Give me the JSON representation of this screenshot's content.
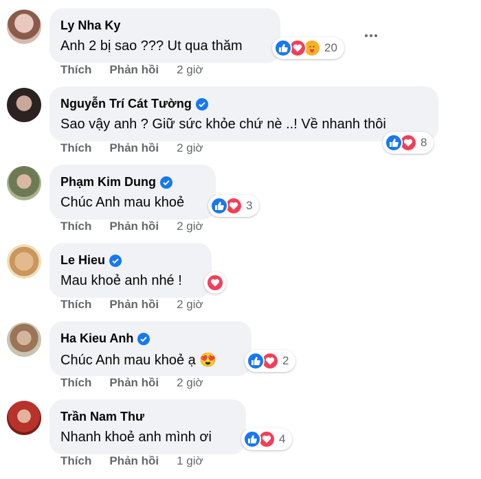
{
  "labels": {
    "like": "Thích",
    "reply": "Phản hồi"
  },
  "colors": {
    "like": "#1877f2",
    "love": "#f33e58",
    "meta": "#65676b",
    "bubble": "#f0f2f5"
  },
  "comments": [
    {
      "author": "Ly Nha Ky",
      "verified": false,
      "text": "Anh 2 bị sao ??? Ut qua thăm",
      "reactions": [
        "like-icon",
        "love-icon",
        "care-icon"
      ],
      "reaction_count": "20",
      "time": "2 giờ"
    },
    {
      "author": "Nguyễn Trí Cát Tường",
      "verified": true,
      "text": "Sao vậy anh ? Giữ sức khỏe chứ nè ..! Về nhanh thôi",
      "reactions": [
        "like-icon",
        "love-icon"
      ],
      "reaction_count": "8",
      "time": "2 giờ"
    },
    {
      "author": "Phạm Kim Dung",
      "verified": true,
      "text": "Chúc Anh mau khoẻ",
      "reactions": [
        "like-icon",
        "love-icon"
      ],
      "reaction_count": "3",
      "time": "2 giờ"
    },
    {
      "author": "Le Hieu",
      "verified": true,
      "text": "Mau khoẻ anh nhé !",
      "reactions": [
        "love-icon"
      ],
      "reaction_count": "",
      "time": "2 giờ"
    },
    {
      "author": "Ha Kieu Anh",
      "verified": true,
      "text": "Chúc Anh mau khoẻ ạ 😍",
      "reactions": [
        "like-icon",
        "love-icon"
      ],
      "reaction_count": "2",
      "time": "2 giờ"
    },
    {
      "author": "Trần Nam Thư",
      "verified": false,
      "text": "Nhanh khoẻ anh mình ơi",
      "reactions": [
        "like-icon",
        "love-icon"
      ],
      "reaction_count": "4",
      "time": "1 giờ"
    }
  ]
}
